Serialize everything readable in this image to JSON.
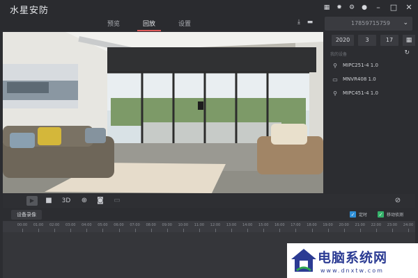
{
  "app": {
    "title": "水星安防"
  },
  "window_controls": {
    "icons": [
      "grid-icon",
      "sun-icon",
      "settings-icon",
      "info-icon"
    ],
    "minimize": "–",
    "maximize": "□",
    "close": "✕"
  },
  "nav": {
    "tabs": [
      {
        "label": "预览"
      },
      {
        "label": "回放"
      },
      {
        "label": "设置"
      }
    ],
    "active_tab": "回放"
  },
  "account": {
    "label": "17859715759"
  },
  "playback": {
    "date": {
      "year": "2020",
      "month": "3",
      "day": "17"
    },
    "devices_label": "我的设备",
    "devices": [
      {
        "name": "MIPC251-4 1.0",
        "icon": "camera-icon"
      },
      {
        "name": "MNVR408 1.0",
        "icon": "nvr-icon"
      },
      {
        "name": "MIPC451-4 1.0",
        "icon": "camera-icon"
      }
    ]
  },
  "controls": {
    "icons": [
      "play-icon",
      "stop-icon",
      "3d-icon",
      "zoom-in-icon",
      "snapshot-icon",
      "record-icon",
      "mute-icon"
    ],
    "three_d_label": "3D"
  },
  "record": {
    "button_label": "设备录像",
    "checks": [
      {
        "label": "定时",
        "checked": true,
        "color": "#2f8fd6"
      },
      {
        "label": "移动侦测",
        "checked": true,
        "color": "#34b26a"
      }
    ]
  },
  "timeline": {
    "hours": [
      "00:00",
      "01:00",
      "02:00",
      "03:00",
      "04:00",
      "05:00",
      "06:00",
      "07:00",
      "08:00",
      "09:00",
      "10:00",
      "11:00",
      "12:00",
      "13:00",
      "14:00",
      "15:00",
      "16:00",
      "17:00",
      "18:00",
      "19:00",
      "20:00",
      "21:00",
      "22:00",
      "23:00",
      "24:00"
    ]
  },
  "watermark": {
    "title": "电脑系统网",
    "url": "www.dnxtw.com"
  }
}
